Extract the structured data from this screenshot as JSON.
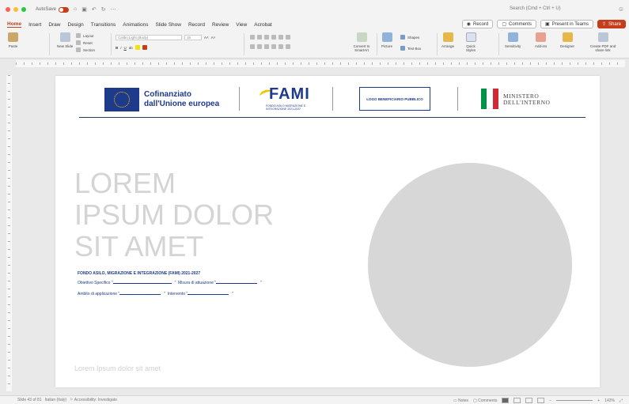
{
  "titlebar": {
    "autosave_label": "AutoSave",
    "search_placeholder": "Search (Cmd + Ctrl + U)",
    "traffic_colors": [
      "#fe5f57",
      "#febc2e",
      "#28c840"
    ]
  },
  "tabs": [
    "Home",
    "Insert",
    "Draw",
    "Design",
    "Transitions",
    "Animations",
    "Slide Show",
    "Record",
    "Review",
    "View",
    "Acrobat"
  ],
  "active_tab": "Home",
  "toolbar": {
    "record_label": "Record",
    "comments_label": "Comments",
    "present_label": "Present in Teams",
    "share_label": "Share"
  },
  "ribbon": {
    "paste": "Paste",
    "new_slide": "New Slide",
    "layout": "Layout",
    "reset": "Reset",
    "section": "Section",
    "font_name": "Calibri Light (Body)",
    "font_size": "16",
    "convert_smartart": "Convert to SmartArt",
    "picture": "Picture",
    "shapes": "Shapes",
    "text_box": "Text Box",
    "arrange": "Arrange",
    "quick_styles": "Quick Styles",
    "sensitivity": "Sensitivity",
    "addins": "Add-ins",
    "designer": "Designer",
    "create_pdf": "Create PDF and share link"
  },
  "slide": {
    "eu_text_line1": "Cofinanziato",
    "eu_text_line2": "dall'Unione europea",
    "fami_word": "FAMI",
    "fami_sub_line1": "FONDO ASILO MIGRAZIONE E",
    "fami_sub_line2": "INTEGRAZIONE 2021-2027",
    "logo_box": "LOGO BENEFICIARIO PUBBLICO",
    "ministero_line1": "MINISTERO",
    "ministero_line2": "DELL'INTERNO",
    "title_line1": "LOREM",
    "title_line2": "IPSUM DOLOR",
    "title_line3": "SIT AMET",
    "fondo": "FONDO ASILO, MIGRAZIONE E INTEGRAZIONE (FAMI) 2021-2027",
    "obiettivo_label": "Obiettivo Specifico \"",
    "obiettivo_end": "\"",
    "misura_label": "Misura di attuazione \"",
    "misura_end": "\"",
    "ambito_label": "Ambito di applicazione \"",
    "ambito_end": "\"",
    "intervento_label": "Intervento \"",
    "intervento_end": "\"",
    "footer": "Lorem Ipsum dolor sit amet",
    "eu_blue": "#1e3a8a",
    "it_flag": [
      "#009246",
      "#ffffff",
      "#ce2b37"
    ]
  },
  "status": {
    "slide": "Slide 43 of 81",
    "language": "Italian (Italy)",
    "accessibility": "Accessibility: Investigate",
    "notes": "Notes",
    "comments": "Comments",
    "zoom": "142%"
  }
}
